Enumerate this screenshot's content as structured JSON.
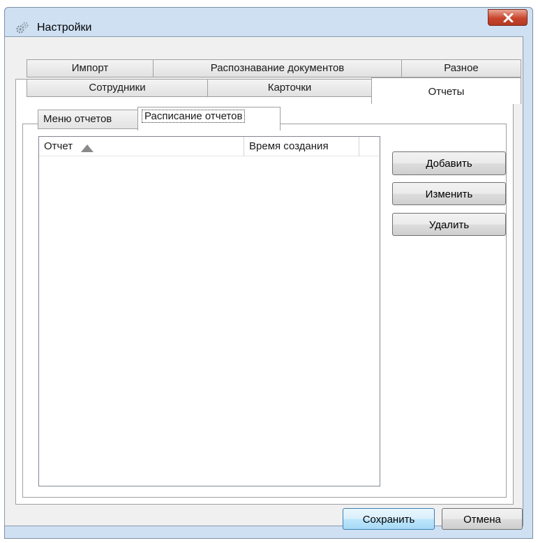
{
  "window": {
    "title": "Настройки"
  },
  "tabs": {
    "row1": [
      "Импорт",
      "Распознавание документов",
      "Разное"
    ],
    "row2": [
      "Сотрудники",
      "Карточки"
    ],
    "active": "Отчеты"
  },
  "subtabs": [
    "Меню отчетов",
    "Расписание отчетов"
  ],
  "list": {
    "columns": [
      "Отчет",
      "Время создания"
    ],
    "rows": []
  },
  "buttons": {
    "add": "Добавить",
    "edit": "Изменить",
    "delete": "Удалить",
    "save": "Сохранить",
    "cancel": "Отмена"
  },
  "icons": {
    "app": "settings-gear-icon",
    "close": "close-icon",
    "sort": "sort-ascending-icon"
  },
  "colors": {
    "frame": "#cfe0f3",
    "close": "#c9452c",
    "default_button": "#bee6fd"
  }
}
